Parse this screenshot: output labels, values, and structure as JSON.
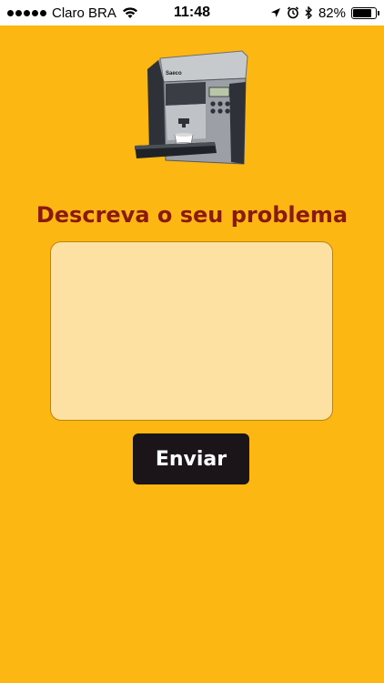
{
  "status_bar": {
    "carrier": "Claro BRA",
    "time": "11:48",
    "battery": "82%",
    "battery_level": 0.82,
    "icons": [
      "signal-dots-icon",
      "wifi-icon",
      "location-icon",
      "alarm-icon",
      "bluetooth-icon",
      "battery-icon"
    ]
  },
  "machine_image": {
    "brand_label": "Saeco",
    "icon": "coffee-machine-image"
  },
  "form": {
    "title": "Descreva o seu problema",
    "textarea_value": "",
    "submit_label": "Enviar"
  },
  "colors": {
    "background": "#FDB713",
    "title": "#8B1A0E",
    "textarea_bg": "#FCE1A3",
    "button_bg": "#1B1418",
    "button_text": "#FFFFFF"
  }
}
